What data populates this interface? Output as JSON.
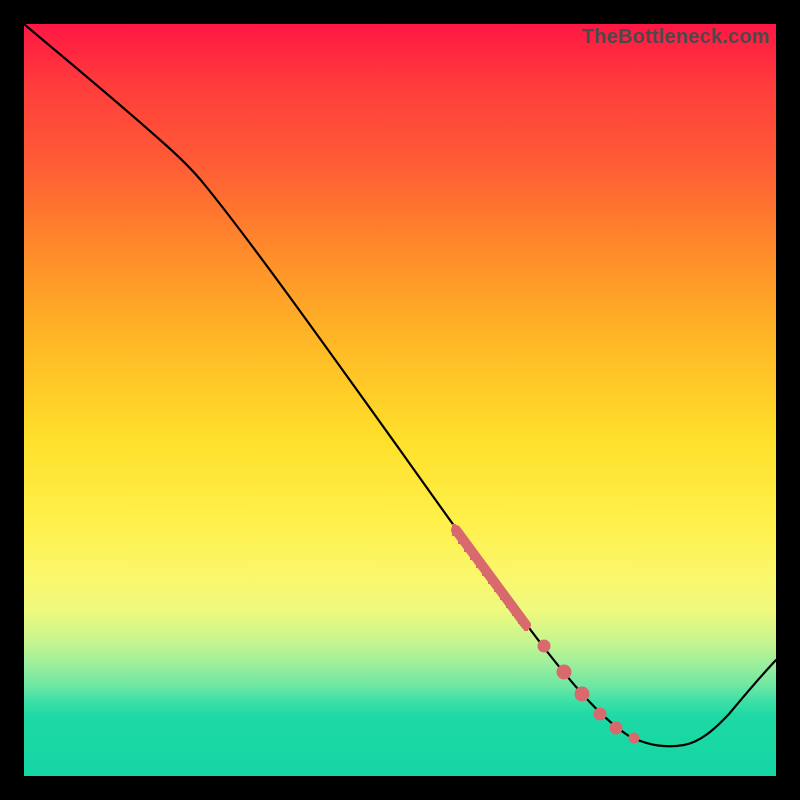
{
  "attribution": "TheBottleneck.com",
  "chart_data": {
    "type": "line",
    "title": "",
    "xlabel": "",
    "ylabel": "",
    "xlim": [
      0,
      100
    ],
    "ylim": [
      0,
      100
    ],
    "grid": false,
    "legend": false,
    "series": [
      {
        "name": "curve",
        "x": [
          0,
          6,
          12,
          18,
          23,
          30,
          40,
          50,
          60,
          68,
          74,
          78,
          82,
          86,
          90,
          94,
          100
        ],
        "y": [
          100,
          95,
          90,
          85,
          80,
          70,
          56,
          42,
          28,
          18,
          11,
          8,
          6,
          5,
          5,
          7,
          14
        ]
      }
    ],
    "highlight_region": {
      "name": "overlay-markers",
      "x_start": 58,
      "x_end": 80,
      "segments_dense": [
        58,
        66
      ],
      "segments_sparse_points": [
        68,
        71,
        74,
        76,
        78,
        80
      ]
    },
    "background_gradient": {
      "top": "#ff1744",
      "mid": "#ffdf2a",
      "bottom": "#14d6a3"
    }
  }
}
